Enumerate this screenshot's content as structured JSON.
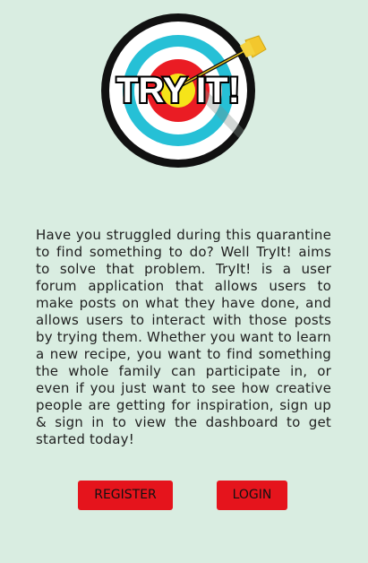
{
  "brand": {
    "logo_text": "TRY IT!",
    "colors": {
      "background": "#d9ede1",
      "button": "#e5141c",
      "text": "#1f1f1f",
      "ring_black": "#111111",
      "ring_white": "#ffffff",
      "ring_blue": "#26c0d6",
      "ring_red": "#ea1c24",
      "ring_yellow": "#f6e419"
    }
  },
  "content": {
    "description": "Have you struggled during this quarantine to find something to do? Well TryIt! aims to solve that problem. TryIt! is a user forum application that allows users to make posts on what they have done, and allows users to interact with those posts by trying them. Whether you want to learn a new recipe, you want to find something the whole family can participate in, or even if you just want to see how creative people are getting for inspiration, sign up & sign in to view the dashboard to get started today!"
  },
  "actions": {
    "register_label": "REGISTER",
    "login_label": "LOGIN"
  }
}
